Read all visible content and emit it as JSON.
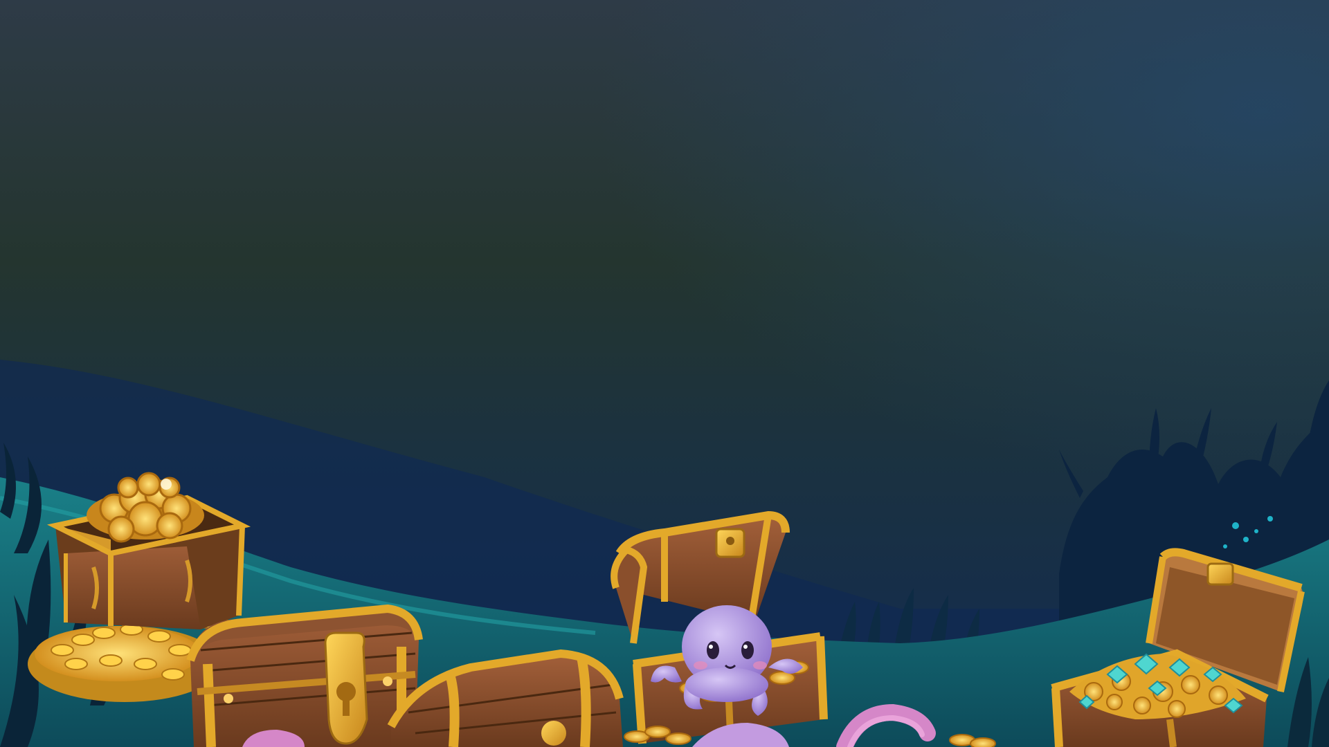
{
  "scene": {
    "palette": {
      "sky_top": "#2b3a48",
      "sky_mid": "#1f3334",
      "sky_low": "#12284a",
      "seabed_far": "#146a74",
      "seabed_near": "#0f5e66",
      "wood": "#8a4f2c",
      "wood_dark": "#5c3219",
      "gold": "#e0a82a",
      "gold_light": "#ffd24a",
      "coin": "#f2b52e",
      "gem_teal": "#4fd6d0",
      "octopus": "#b89ee8",
      "octopus_shadow": "#8c6ec9",
      "tentacle_pink": "#d587c8",
      "seaweed": "#0c2740"
    },
    "elements": [
      {
        "name": "closed-chest-with-coins",
        "kind": "box-chest"
      },
      {
        "name": "locked-treasure-chest",
        "kind": "dome-chest"
      },
      {
        "name": "barrel-chest",
        "kind": "dome-chest"
      },
      {
        "name": "octopus-in-chest",
        "kind": "open-chest"
      },
      {
        "name": "gem-filled-chest",
        "kind": "open-chest"
      },
      {
        "name": "pink-tentacle",
        "kind": "tentacle"
      }
    ]
  }
}
